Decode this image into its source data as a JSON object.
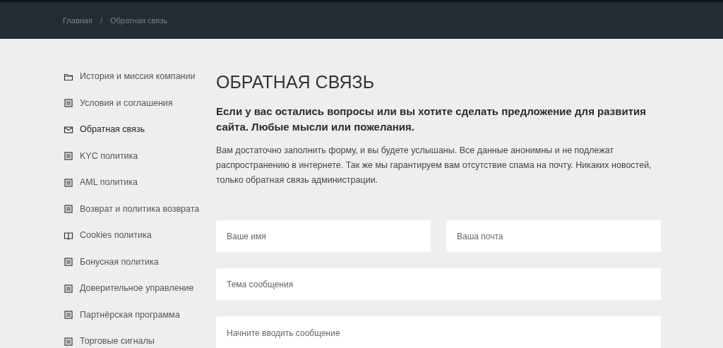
{
  "breadcrumbs": [
    {
      "label": "Главная",
      "kind": "link"
    },
    {
      "label": "/",
      "kind": "separator"
    },
    {
      "label": "Обратная связь",
      "kind": "current"
    }
  ],
  "sidebar": {
    "items": [
      {
        "label": "История и миссия компании",
        "kind": "folder",
        "selected": false
      },
      {
        "label": "Условия и соглашения",
        "kind": "document",
        "selected": false
      },
      {
        "label": "Обратная связь",
        "kind": "mail",
        "selected": true
      },
      {
        "label": "KYC политика",
        "kind": "document",
        "selected": false
      },
      {
        "label": "AML политика",
        "kind": "document",
        "selected": false
      },
      {
        "label": "Возврат и политика возврата",
        "kind": "document",
        "selected": false
      },
      {
        "label": "Cookies политика",
        "kind": "book",
        "selected": false
      },
      {
        "label": "Бонусная политика",
        "kind": "document",
        "selected": false
      },
      {
        "label": "Доверительное управление",
        "kind": "document",
        "selected": false
      },
      {
        "label": "Партнёрская программа",
        "kind": "document",
        "selected": false
      },
      {
        "label": "Торговые сигналы",
        "kind": "document",
        "selected": false
      }
    ]
  },
  "content": {
    "title": "ОБРАТНАЯ СВЯЗЬ",
    "lead": "Если у вас остались вопросы или вы хотите сделать предложение для развития сайта. Любые мысли или пожелания.",
    "text": "Вам достаточно заполнить форму, и вы будете услышаны. Все данные анонимны и не подлежат распространению в интернете. Так же мы гарантируем вам отсутствие спама на почту. Никаких новостей, только обратная связь администрации."
  },
  "form": {
    "name": {
      "placeholder": "Ваше имя"
    },
    "email": {
      "placeholder": "Ваша почта"
    },
    "subject": {
      "placeholder": "Тема сообщения"
    },
    "message": {
      "placeholder": "Начните вводить сообщение"
    }
  }
}
